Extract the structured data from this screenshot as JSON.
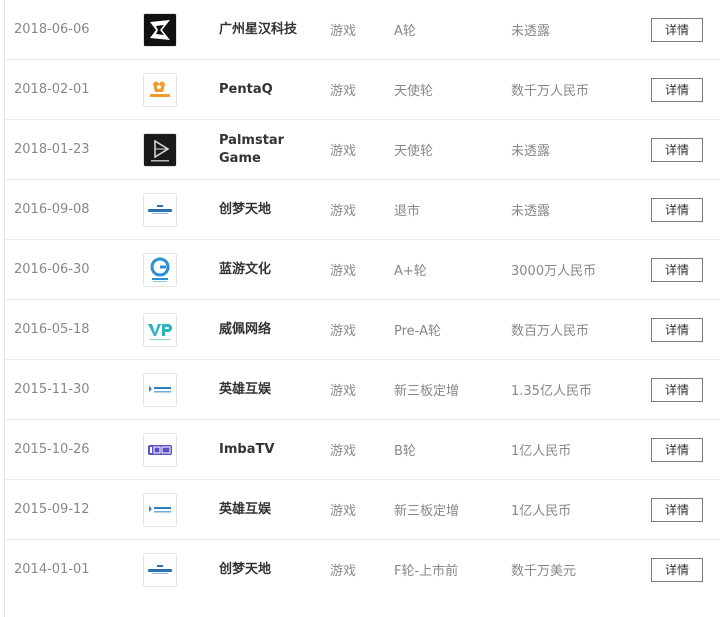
{
  "rows": [
    {
      "date": "2018-06-06",
      "logo": "xinghan-logo-icon",
      "name": "广州星汉科技",
      "industry": "游戏",
      "round": "A轮",
      "amount": "未透露",
      "detail": "详情"
    },
    {
      "date": "2018-02-01",
      "logo": "pentaq-logo-icon",
      "name": "PentaQ",
      "industry": "游戏",
      "round": "天使轮",
      "amount": "数千万人民币",
      "detail": "详情"
    },
    {
      "date": "2018-01-23",
      "logo": "palmstar-logo-icon",
      "name": "Palmstar Game",
      "industry": "游戏",
      "round": "天使轮",
      "amount": "未透露",
      "detail": "详情"
    },
    {
      "date": "2016-09-08",
      "logo": "chuangmeng-logo-icon",
      "name": "创梦天地",
      "industry": "游戏",
      "round": "退市",
      "amount": "未透露",
      "detail": "详情"
    },
    {
      "date": "2016-06-30",
      "logo": "lanyou-logo-icon",
      "name": "蓝游文化",
      "industry": "游戏",
      "round": "A+轮",
      "amount": "3000万人民币",
      "detail": "详情"
    },
    {
      "date": "2016-05-18",
      "logo": "vpgame-logo-icon",
      "name": "威佩网络",
      "industry": "游戏",
      "round": "Pre-A轮",
      "amount": "数百万人民币",
      "detail": "详情"
    },
    {
      "date": "2015-11-30",
      "logo": "yingxiong-logo-icon",
      "name": "英雄互娱",
      "industry": "游戏",
      "round": "新三板定增",
      "amount": "1.35亿人民币",
      "detail": "详情"
    },
    {
      "date": "2015-10-26",
      "logo": "imbatv-logo-icon",
      "name": "ImbaTV",
      "industry": "游戏",
      "round": "B轮",
      "amount": "1亿人民币",
      "detail": "详情"
    },
    {
      "date": "2015-09-12",
      "logo": "yingxiong-logo-icon",
      "name": "英雄互娱",
      "industry": "游戏",
      "round": "新三板定增",
      "amount": "1亿人民币",
      "detail": "详情"
    },
    {
      "date": "2014-01-01",
      "logo": "chuangmeng-logo-icon",
      "name": "创梦天地",
      "industry": "游戏",
      "round": "F轮-上市前",
      "amount": "数千万美元",
      "detail": "详情"
    }
  ]
}
